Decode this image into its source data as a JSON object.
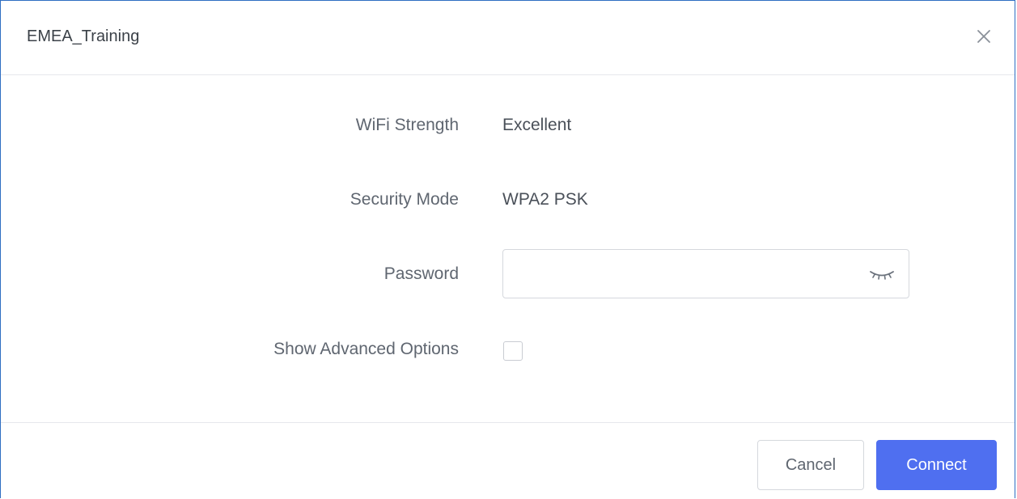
{
  "dialog": {
    "title": "EMEA_Training",
    "close_icon": "close-icon"
  },
  "fields": {
    "wifi_strength": {
      "label": "WiFi Strength",
      "value": "Excellent"
    },
    "security_mode": {
      "label": "Security Mode",
      "value": "WPA2 PSK"
    },
    "password": {
      "label": "Password",
      "value": "",
      "placeholder": "",
      "toggle_icon": "eye-closed-icon"
    },
    "advanced": {
      "label": "Show Advanced Options",
      "checked": false
    }
  },
  "footer": {
    "cancel_label": "Cancel",
    "connect_label": "Connect"
  },
  "colors": {
    "accent": "#4f6ff0",
    "border": "#2f6ec2"
  }
}
